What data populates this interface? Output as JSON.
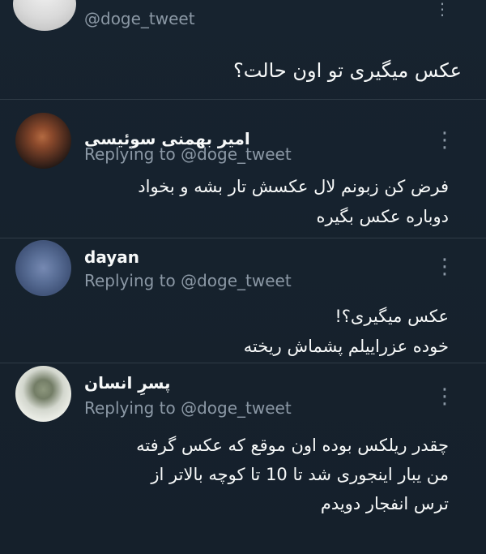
{
  "thread": {
    "top_tweet": {
      "username": "@doge_tweet",
      "text": "عکس میگیری تو اون حالت؟"
    },
    "replies": [
      {
        "name": "امیر بهمنی سوئیسی",
        "replying_to": "Replying to @doge_tweet",
        "lines": [
          "فرض کن زبونم لال عکسش تار بشه و بخواد",
          "دوباره عکس بگیره"
        ]
      },
      {
        "name": "dayan",
        "replying_to": "Replying to @doge_tweet",
        "lines": [
          "عکس میگیری؟!",
          "خوده عزراییلم پشماش ریخته"
        ]
      },
      {
        "name": "پسرِ انسان",
        "replying_to": "Replying to @doge_tweet",
        "lines": [
          "چقدر ریلکس بوده اون موقع که عکس گرفته",
          "من یبار اینجوری شد تا 10 تا کوچه بالاتر از",
          "ترس انفجار دویدم"
        ]
      }
    ],
    "icons": {
      "more": "⋮"
    }
  }
}
